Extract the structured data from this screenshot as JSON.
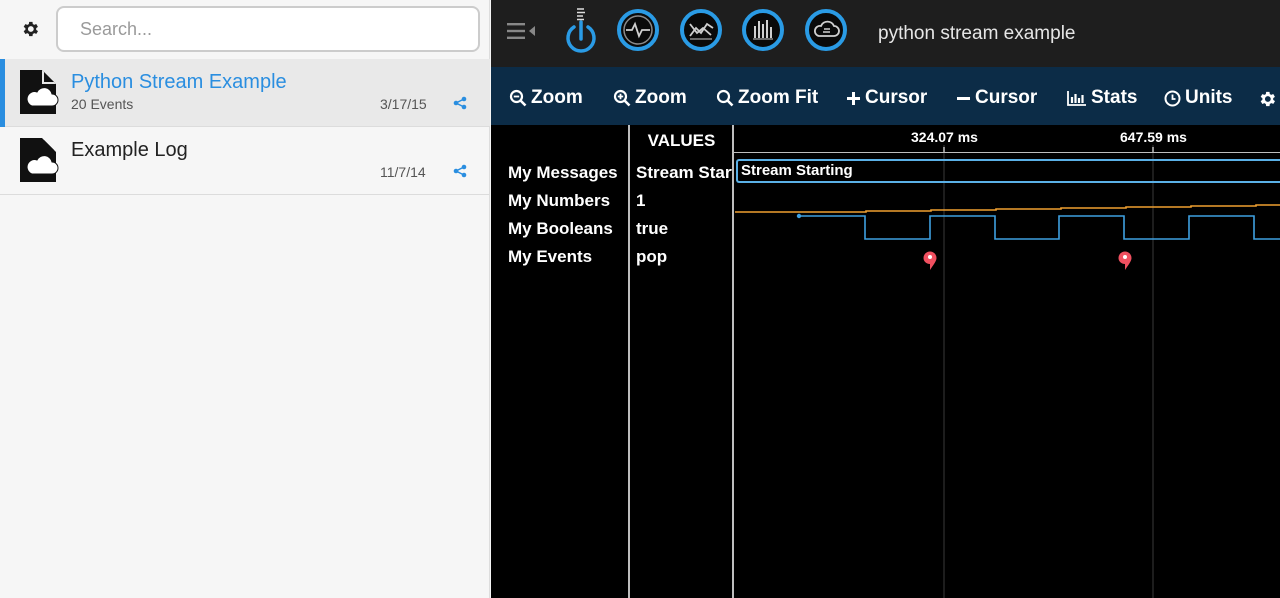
{
  "sidebar": {
    "search": {
      "placeholder": "Search...",
      "value": ""
    },
    "logs": [
      {
        "name": "Python Stream Example",
        "events": "20 Events",
        "date": "3/17/15",
        "selected": true
      },
      {
        "name": "Example Log",
        "events": "",
        "date": "11/7/14",
        "selected": false
      }
    ]
  },
  "header": {
    "title": "python stream example"
  },
  "toolbar": {
    "zoom_out": "Zoom",
    "zoom_in": "Zoom",
    "zoom_fit": "Zoom Fit",
    "add_cursor": "Cursor",
    "remove_cursor": "Cursor",
    "stats": "Stats",
    "units": "Units"
  },
  "viewer": {
    "values_header": "VALUES",
    "ticks": [
      "324.07 ms",
      "647.59 ms"
    ],
    "signals": [
      {
        "name": "My Messages",
        "value": "Stream Starting"
      },
      {
        "name": "My Numbers",
        "value": "1"
      },
      {
        "name": "My Booleans",
        "value": "true"
      },
      {
        "name": "My Events",
        "value": "pop"
      }
    ],
    "message_text": "Stream Starting"
  },
  "colors": {
    "accent": "#2a8ee0",
    "toolbar_bg": "#0c2c47",
    "number_line": "#f0a030",
    "boolean_line": "#3ea0e0",
    "event_marker": "#f05060",
    "message_border": "#5ab0e6"
  }
}
